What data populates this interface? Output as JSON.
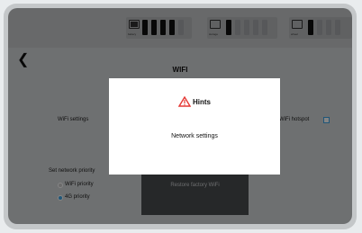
{
  "status_bar": {
    "battery_label": "battery",
    "storage_label": "storage",
    "wheel_label": "wheel"
  },
  "header": {
    "back_icon": "chevron-left-icon",
    "title": "WIFI"
  },
  "wifi_settings": {
    "label": "WiFi settings"
  },
  "wifi_hotspot": {
    "label": "WiFi hotspot",
    "checked": false
  },
  "network_priority": {
    "label": "Set network priority",
    "options": [
      "WiFi priority",
      "4G priority"
    ],
    "selected": "4G priority"
  },
  "restore": {
    "label": "Restore factory WiFi"
  },
  "dialog": {
    "title": "Hints",
    "icon": "warning-icon",
    "message": "Network settings"
  },
  "colors": {
    "accent": "#3fa6e6",
    "warning": "#e53935"
  }
}
